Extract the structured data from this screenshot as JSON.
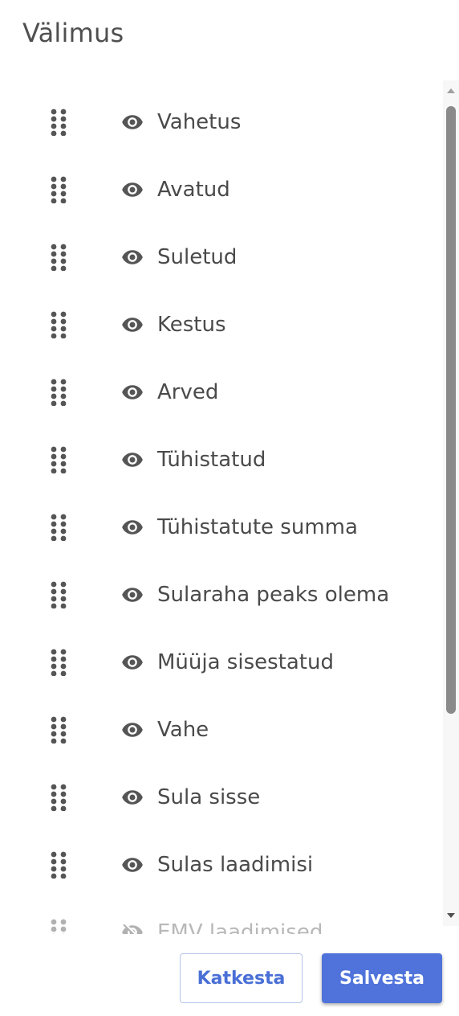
{
  "dialog": {
    "title": "Välimus"
  },
  "columns": [
    {
      "label": "Vahetus",
      "visible": true
    },
    {
      "label": "Avatud",
      "visible": true
    },
    {
      "label": "Suletud",
      "visible": true
    },
    {
      "label": "Kestus",
      "visible": true
    },
    {
      "label": "Arved",
      "visible": true
    },
    {
      "label": "Tühistatud",
      "visible": true
    },
    {
      "label": "Tühistatute summa",
      "visible": true
    },
    {
      "label": "Sularaha peaks olema",
      "visible": true
    },
    {
      "label": "Müüja sisestatud",
      "visible": true
    },
    {
      "label": "Vahe",
      "visible": true
    },
    {
      "label": "Sula sisse",
      "visible": true
    },
    {
      "label": "Sulas laadimisi",
      "visible": true
    },
    {
      "label": "EMV laadimised",
      "visible": false
    }
  ],
  "icons": {
    "drag": "drag-handle-icon",
    "visible": "eye-icon",
    "hidden": "eye-off-icon"
  },
  "colors": {
    "primary": "#4f73db",
    "text": "#4a4a4a",
    "icon": "#555555"
  },
  "buttons": {
    "cancel_label": "Katkesta",
    "save_label": "Salvesta"
  }
}
